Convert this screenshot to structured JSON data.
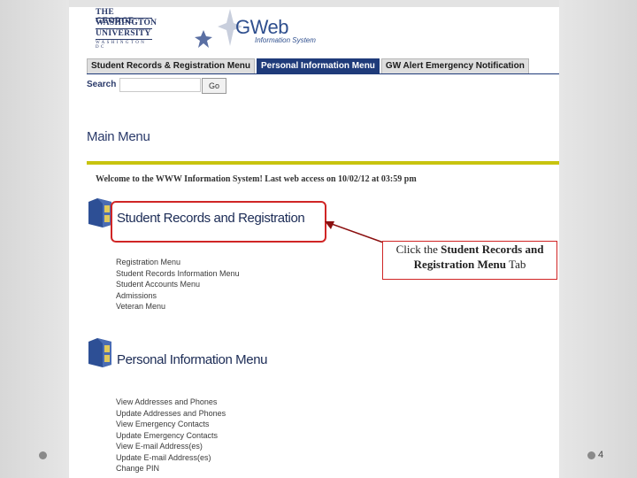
{
  "slide": {
    "page_number": "4"
  },
  "header": {
    "university_logo": [
      "THE GEORGE",
      "WASHINGTON",
      "UNIVERSITY",
      "WASHINGTON DC"
    ],
    "app_title": "GWeb",
    "app_subtitle": "Information System"
  },
  "tabs": [
    {
      "label": "Student Records & Registration Menu",
      "active": false
    },
    {
      "label": "Personal Information Menu",
      "active": true
    },
    {
      "label": "GW Alert Emergency Notification",
      "active": false
    }
  ],
  "search": {
    "label": "Search",
    "value": "",
    "button_label": "Go"
  },
  "main": {
    "title": "Main Menu",
    "welcome": "Welcome to the WWW Information System! Last web access on 10/02/12 at 03:59 pm"
  },
  "sections": [
    {
      "title": "Student Records and Registration",
      "items": [
        "Registration Menu",
        "Student Records Information Menu",
        "Student Accounts Menu",
        "Admissions",
        "Veteran Menu"
      ]
    },
    {
      "title": "Personal Information Menu",
      "items": [
        "View Addresses and Phones",
        "Update Addresses and Phones",
        "View Emergency Contacts",
        "Update Emergency Contacts",
        "View E-mail Address(es)",
        "Update E-mail Address(es)",
        "Change PIN"
      ]
    }
  ],
  "callout": {
    "prefix": "Click the ",
    "bold": "Student Records and Registration Menu",
    "suffix": " Tab"
  },
  "colors": {
    "accent": "#d02525",
    "nav": "#1f3b7a",
    "rule": "#c8c40f"
  }
}
